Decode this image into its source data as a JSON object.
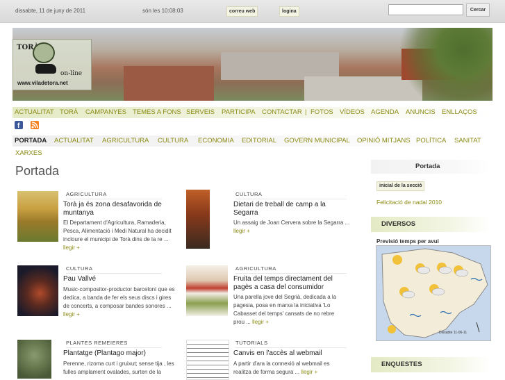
{
  "topbar": {
    "date": "dissabte, 11 de juny de 2011",
    "time": "són les 10:08:03",
    "mail_label": "correu web",
    "login_label": "logina",
    "search_button": "Cercar",
    "search_value": ""
  },
  "logo": {
    "vertical_text": "TORÀ",
    "tagline": "on-line",
    "url": "www.viladetora.net"
  },
  "main_nav": [
    "ACTUALITAT",
    "TORÀ",
    "CAMPANYES",
    "TEMES A FONS",
    "SERVEIS",
    "PARTICIPA",
    "CONTACTAR",
    "|",
    "FOTOS",
    "VÍDEOS",
    "AGENDA",
    "ANUNCIS",
    "ENLLAÇOS"
  ],
  "social": {
    "facebook": "facebook-icon",
    "rss": "rss-icon",
    "facebook_color": "#3b5998",
    "rss_color": "#f58220"
  },
  "sub_nav": [
    "PORTADA",
    "ACTUALITAT",
    "AGRICULTURA",
    "CULTURA",
    "ECONOMIA",
    "EDITORIAL",
    "GOVERN MUNICIPAL",
    "OPINIÓ MITJANS",
    "POLÍTICA",
    "SANITAT"
  ],
  "sub_nav_extra": "XARXES",
  "page_title": "Portada",
  "articles": [
    {
      "category": "AGRICULTURA",
      "title": "Torà ja és zona desafavorida de muntanya",
      "desc": "El Departament d'Agricultura, Ramaderia, Pesca, Alimentació i Medi Natural ha decidit incloure el municipi de Torà dins de la re ...",
      "more": "llegir +"
    },
    {
      "category": "CULTURA",
      "title": "Dietari de treball de camp a la Segarra",
      "desc": "Un assaig de Joan Cervera sobre la Segarra ...",
      "more": "llegir +"
    },
    {
      "category": "CULTURA",
      "title": "Pau Vallvé",
      "desc": "Music-compositor-productor barceloní que es dedica, a banda de fer els seus discs i gires de concerts, a composar bandes sonores ...",
      "more": "llegir +"
    },
    {
      "category": "AGRICULTURA",
      "title": "Fruita del temps directament del pagès a casa del consumidor",
      "desc": "Una parella jove del Segrià, dedicada a la pagesia, posa en marxa la iniciativa 'Lo Cabasset del temps' cansats de no rebre prou ...",
      "more": "llegir +"
    },
    {
      "category": "PLANTES REMEIERES",
      "title": "Plantatge (Plantago major)",
      "desc": "Perenne, rizoma curt i gruixut; sense tija , les fulles amplament ovalades, surten de la",
      "more": ""
    },
    {
      "category": "TUTORIALS",
      "title": "Canvis en l'accès al webmail",
      "desc": "A partir d'ara la connexió al webmail es realitza de forma segura ...",
      "more": "llegir +"
    }
  ],
  "sidebar": {
    "portada_heading": "Portada",
    "inicial_label": "inicial de la secció",
    "link": "Felicitació de nadal 2010",
    "diversos_heading": "DIVERSOS",
    "weather_label": "Previsió temps per avui",
    "map_caption": "Dissabte 11-06-11",
    "enquestes_heading": "ENQUESTES"
  },
  "colors": {
    "accent": "#8a8a14",
    "nav_bg": "#e4eac4"
  }
}
